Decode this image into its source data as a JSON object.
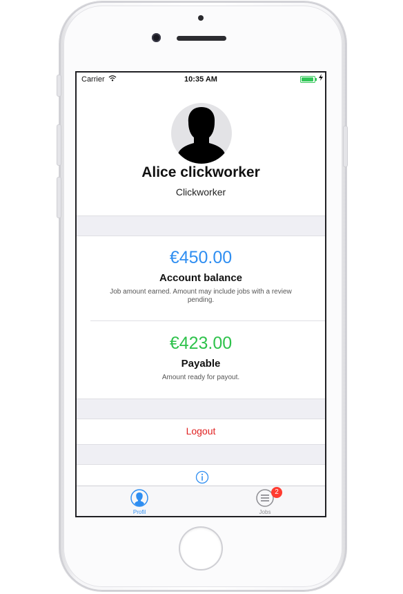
{
  "status_bar": {
    "carrier": "Carrier",
    "time": "10:35 AM"
  },
  "profile": {
    "name": "Alice clickworker",
    "role": "Clickworker"
  },
  "balance": {
    "amount": "€450.00",
    "title": "Account balance",
    "description": "Job amount earned. Amount may include jobs with a review pending.",
    "color": "#2f8ef1"
  },
  "payable": {
    "amount": "€423.00",
    "title": "Payable",
    "description": "Amount ready for payout.",
    "color": "#2ec24b"
  },
  "logout": {
    "label": "Logout",
    "color": "#e02020"
  },
  "tabbar": {
    "tabs": [
      {
        "label": "Profil",
        "icon": "profile-icon",
        "active": true
      },
      {
        "label": "Jobs",
        "icon": "list-icon",
        "badge": "2",
        "active": false
      }
    ],
    "active_color": "#2f8ef1",
    "inactive_color": "#8e8e93"
  },
  "icons": {
    "info": "info-icon",
    "wifi": "wifi-icon",
    "battery": "battery-icon"
  }
}
